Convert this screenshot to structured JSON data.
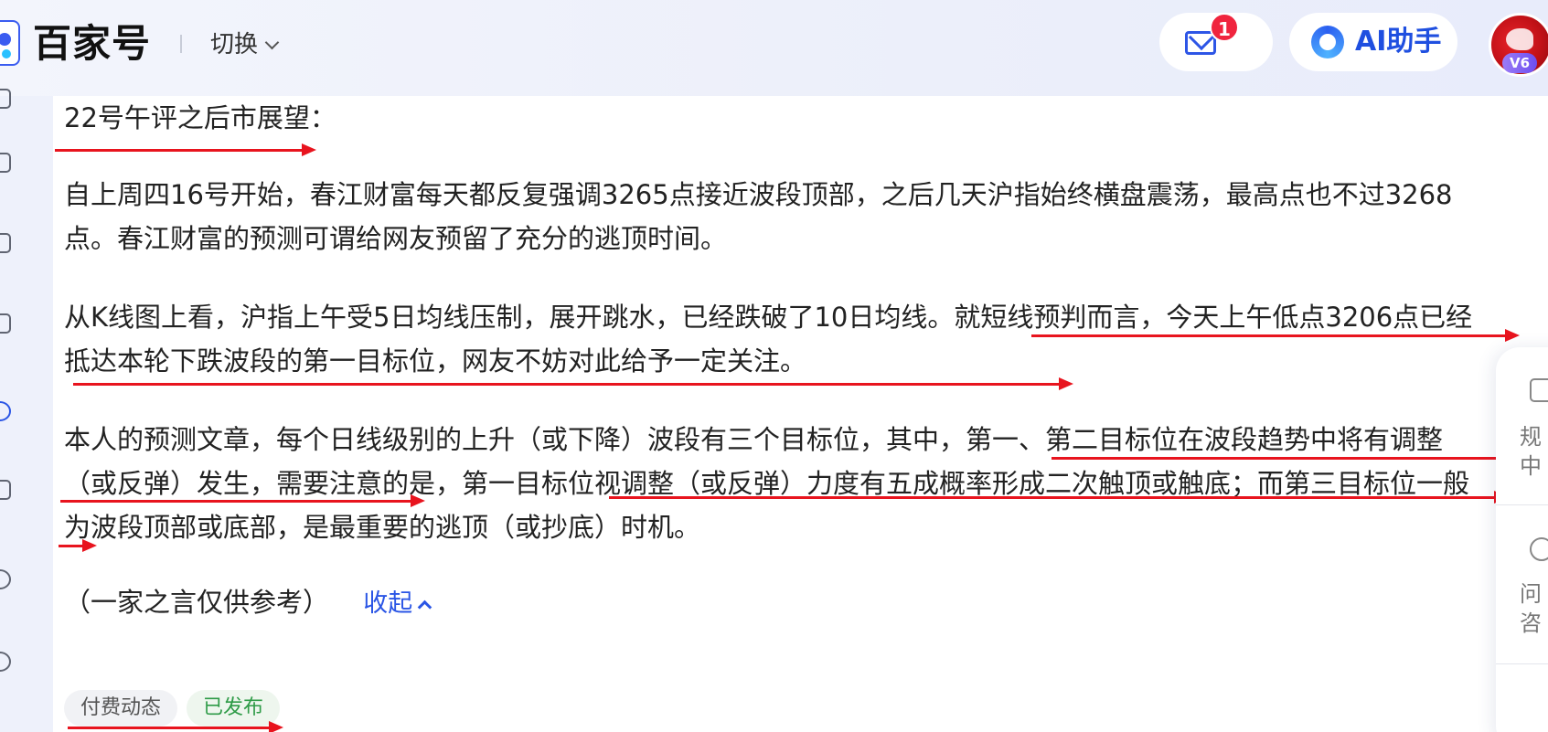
{
  "header": {
    "brand": "百家号",
    "switch_label": "切换",
    "mail_badge": "1",
    "ai_label": "AI助手",
    "avatar_level": "V6"
  },
  "article": {
    "title": "22号午评之后市展望：",
    "para1": "自上周四16号开始，春江财富每天都反复强调3265点接近波段顶部，之后几天沪指始终横盘震荡，最高点也不过3268点。春江财富的预测可谓给网友预留了充分的逃顶时间。",
    "para2": "从K线图上看，沪指上午受5日均线压制，展开跳水，已经跌破了10日均线。就短线预判而言，今天上午低点3206点已经抵达本轮下跌波段的第一目标位，网友不妨对此给予一定关注。",
    "para3": "本人的预测文章，每个日线级别的上升（或下降）波段有三个目标位，其中，第一、第二目标位在波段趋势中将有调整（或反弹）发生，需要注意的是，第一目标位视调整（或反弹）力度有五成概率形成二次触顶或触底；而第三目标位一般为波段顶部或底部，是最重要的逃顶（或抄底）时机。",
    "disclaimer": "（一家之言仅供参考）",
    "fold_label": "收起"
  },
  "tags": [
    "付费动态",
    "已发布"
  ],
  "right_panel": {
    "item1_line1": "规",
    "item1_line2": "中",
    "item2_line1": "问",
    "item2_line2": "咨"
  },
  "colors": {
    "accent": "#2a55e5",
    "annotation_red": "#e8141e",
    "badge_red": "#f0243e",
    "published_green": "#2e9b47"
  }
}
